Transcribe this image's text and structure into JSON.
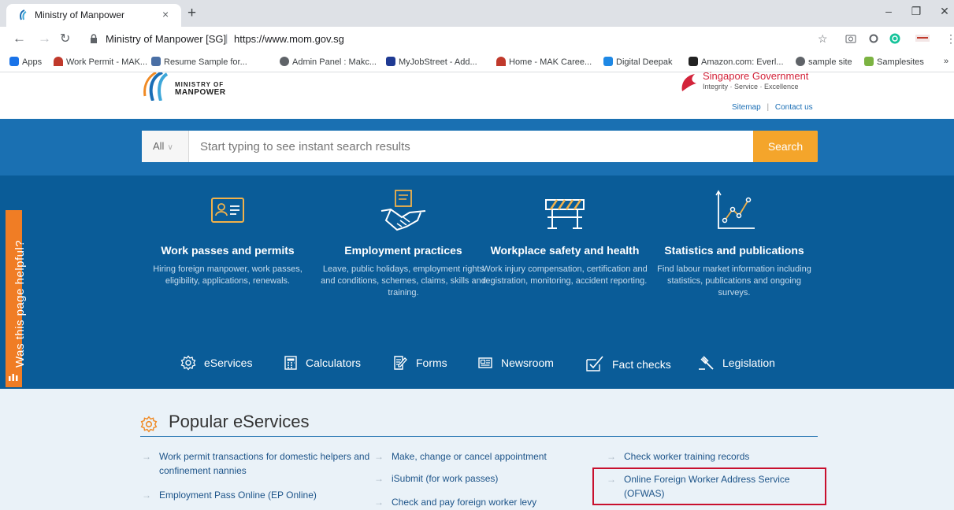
{
  "browser": {
    "tab_title": "Ministry of Manpower",
    "tab_close": "×",
    "new_tab": "+",
    "window": {
      "minimize": "–",
      "restore": "❐",
      "close": "✕"
    },
    "url_site": "Ministry of Manpower [SG]",
    "url_sep": "|",
    "url": "https://www.mom.gov.sg",
    "bookmarks": [
      {
        "label": "Apps",
        "color": "#1a73e8"
      },
      {
        "label": "Work Permit - MAK...",
        "color": "#c0392b"
      },
      {
        "label": "Resume Sample for...",
        "color": "#4a6fa5"
      },
      {
        "label": "Admin Panel : Makc...",
        "color": "#5f6368"
      },
      {
        "label": "MyJobStreet - Add...",
        "color": "#1f3a93"
      },
      {
        "label": "Home - MAK Caree...",
        "color": "#c0392b"
      },
      {
        "label": "Digital Deepak",
        "color": "#1e88e5"
      },
      {
        "label": "Amazon.com: Everl...",
        "color": "#222222"
      },
      {
        "label": "sample site",
        "color": "#5f6368"
      },
      {
        "label": "Samplesites",
        "color": "#7cb342"
      }
    ],
    "bookmarks_more": "»"
  },
  "header": {
    "logo_line1": "MINISTRY OF",
    "logo_line2": "MANPOWER",
    "gov_title": "Singapore Government",
    "gov_tagline": "Integrity · Service · Excellence",
    "sitemap": "Sitemap",
    "link_sep": "|",
    "contact": "Contact us"
  },
  "search": {
    "scope": "All",
    "placeholder": "Start typing to see instant search results",
    "button": "Search"
  },
  "cards": [
    {
      "icon": "id-card-icon",
      "title": "Work passes and permits",
      "desc": "Hiring foreign manpower, work passes, eligibility, applications, renewals."
    },
    {
      "icon": "handshake-icon",
      "title": "Employment practices",
      "desc": "Leave, public holidays, employment rights and conditions, schemes, claims, skills and training."
    },
    {
      "icon": "barrier-icon",
      "title": "Workplace safety and health",
      "desc": "Work injury compensation, certification and registration, monitoring, accident reporting."
    },
    {
      "icon": "line-chart-icon",
      "title": "Statistics and publications",
      "desc": "Find labour market information including statistics, publications and ongoing surveys."
    }
  ],
  "quicklinks": [
    {
      "icon": "gear-icon",
      "label": "eServices"
    },
    {
      "icon": "calculator-icon",
      "label": "Calculators"
    },
    {
      "icon": "form-icon",
      "label": "Forms"
    },
    {
      "icon": "newspaper-icon",
      "label": "Newsroom"
    },
    {
      "icon": "check-icon",
      "label": "Fact checks"
    },
    {
      "icon": "gavel-icon",
      "label": "Legislation"
    }
  ],
  "feedback": "Was this page helpful?",
  "popular": {
    "title": "Popular eServices",
    "links": [
      "Work permit transactions for domestic helpers and confinement nannies",
      "Employment Pass Online (EP Online)",
      "Make, change or cancel appointment",
      "iSubmit (for work passes)",
      "Check and pay foreign worker levy",
      "Check worker training records",
      "Online Foreign Worker Address Service (OFWAS)"
    ]
  },
  "colors": {
    "band": "#0a5c98",
    "search_strip": "#1a70b2",
    "search_button": "#f4a52b",
    "feedback_tab": "#f07d25",
    "highlight": "#c8102e"
  }
}
